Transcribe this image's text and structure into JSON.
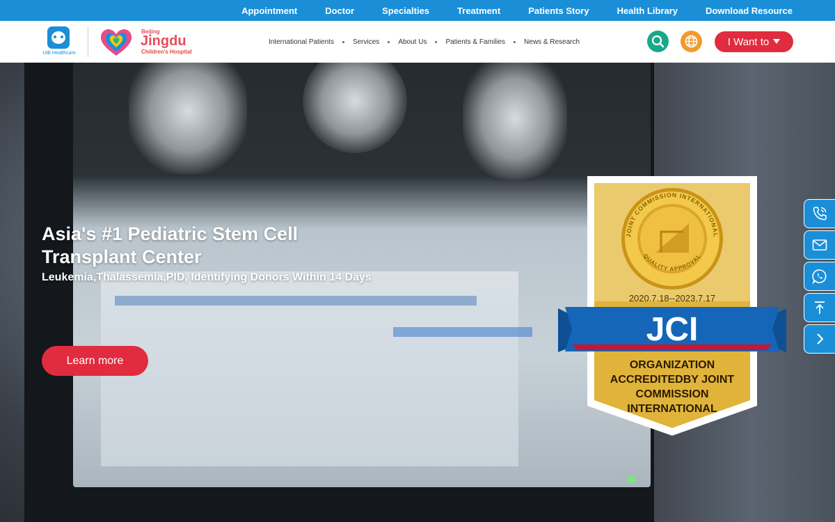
{
  "topbar": {
    "links": [
      "Appointment",
      "Doctor",
      "Specialties",
      "Treatment",
      "Patients Story",
      "Health Library",
      "Download Resource"
    ]
  },
  "header": {
    "uib_logo_text": "UIB Healthcare",
    "hospital_logo": {
      "city": "Beijing",
      "brand": "Jingdu",
      "subtitle": "Children's Hospital"
    },
    "nav": [
      "International Patients",
      "Services",
      "About Us",
      "Patients & Families",
      "News & Research"
    ],
    "want_button": "I Want to"
  },
  "hero": {
    "title": "Asia's #1 Pediatric Stem Cell Transplant Center",
    "subtitle": "Leukemia,Thalassemia,PID, Identifying Donors Within 14 Days",
    "cta": "Learn more"
  },
  "jci_badge": {
    "ring_text": "JOINT COMMISSION INTERNATIONAL",
    "ring_bottom": "QUALITY APPROVAL",
    "dates": "2020.7.18--2023.7.17",
    "label": "JCI",
    "line1": "ORGANIZATION",
    "line2": "ACCREDITEDBY JOINT",
    "line3": "COMMISSION",
    "line4": "INTERNATIONAL"
  },
  "float_tools": [
    "phone-icon",
    "mail-icon",
    "whatsapp-icon",
    "back-to-top-icon",
    "chevron-right-icon"
  ],
  "colors": {
    "topbar": "#1a8fd8",
    "accent_red": "#e02c3e",
    "search_green": "#1aa88a",
    "globe_orange": "#f19b2c",
    "float_blue": "#1a8fd8",
    "jci_blue": "#1565b8",
    "jci_gold": "#e0b43a"
  }
}
